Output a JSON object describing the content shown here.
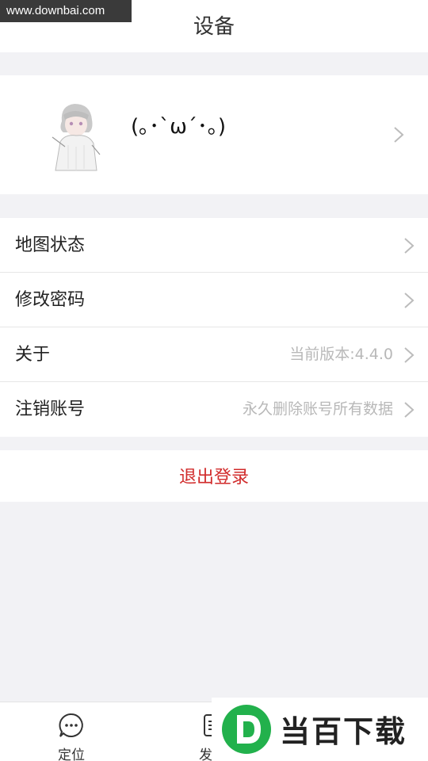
{
  "watermark_top": "www.downbai.com",
  "header": {
    "title": "设备"
  },
  "profile": {
    "nickname": "(｡･`ω´･｡)"
  },
  "menu": [
    {
      "label": "地图状态",
      "value": ""
    },
    {
      "label": "修改密码",
      "value": ""
    },
    {
      "label": "关于",
      "value": "当前版本:4.4.0"
    },
    {
      "label": "注销账号",
      "value": "永久删除账号所有数据"
    }
  ],
  "logout_label": "退出登录",
  "tabs": [
    {
      "label": "定位",
      "icon": "chat-bubble-icon"
    },
    {
      "label": "发现",
      "icon": "list-icon"
    }
  ],
  "watermark_bottom": "当百下载",
  "colors": {
    "accent_red": "#d12b2b",
    "background": "#f2f2f5",
    "watermark_green": "#22b14c"
  }
}
